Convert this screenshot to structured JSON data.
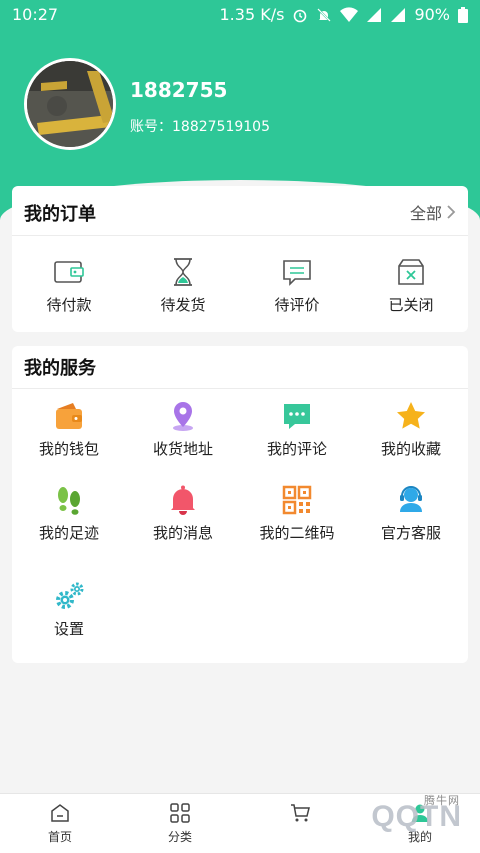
{
  "status_bar": {
    "time": "10:27",
    "speed": "1.35 K/s",
    "battery": "90%"
  },
  "profile": {
    "username": "1882755",
    "account_label": "账号：18827519105"
  },
  "orders": {
    "title": "我的订单",
    "all_label": "全部",
    "items": [
      {
        "label": "待付款",
        "icon": "wallet-outline-icon"
      },
      {
        "label": "待发货",
        "icon": "hourglass-icon"
      },
      {
        "label": "待评价",
        "icon": "comment-outline-icon"
      },
      {
        "label": "已关闭",
        "icon": "closed-box-icon"
      }
    ]
  },
  "services": {
    "title": "我的服务",
    "items": [
      {
        "label": "我的钱包",
        "icon": "wallet-icon",
        "color": "#f7a23b"
      },
      {
        "label": "收货地址",
        "icon": "location-pin-icon",
        "color": "#a874e8"
      },
      {
        "label": "我的评论",
        "icon": "chat-bubble-icon",
        "color": "#37c79a"
      },
      {
        "label": "我的收藏",
        "icon": "star-icon",
        "color": "#f6b21b"
      },
      {
        "label": "我的足迹",
        "icon": "footprints-icon",
        "color": "#7bc247"
      },
      {
        "label": "我的消息",
        "icon": "bell-icon",
        "color": "#f2566a"
      },
      {
        "label": "我的二维码",
        "icon": "qr-code-icon",
        "color": "#f2892f"
      },
      {
        "label": "官方客服",
        "icon": "headset-agent-icon",
        "color": "#2fa9e8"
      },
      {
        "label": "设置",
        "icon": "gears-icon",
        "color": "#31b8c9"
      }
    ]
  },
  "tabbar": {
    "items": [
      {
        "label": "首页",
        "icon": "home-icon"
      },
      {
        "label": "分类",
        "icon": "grid-icon"
      },
      {
        "label": "",
        "icon": "cart-icon"
      },
      {
        "label": "我的",
        "icon": "user-icon"
      }
    ]
  },
  "watermark": {
    "text": "QQTN",
    "subtext": "腾牛网"
  }
}
